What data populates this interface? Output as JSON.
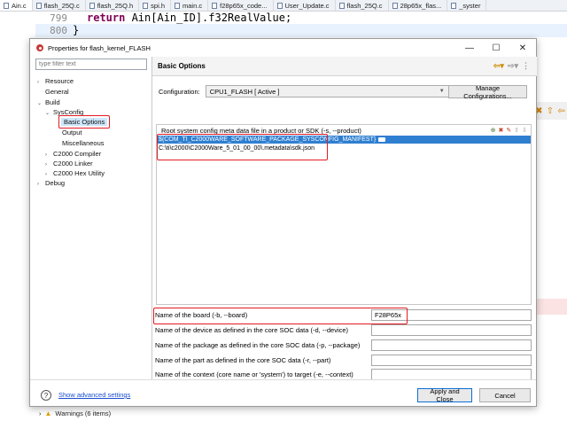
{
  "editor": {
    "tabs": [
      "Ain.c",
      "flash_25Q.c",
      "flash_25Q.h",
      "spi.h",
      "main.c",
      "f28p65x_code...",
      "User_Update.c",
      "flash_25Q.c",
      "28p65x_flas...",
      "_syster"
    ],
    "lines": [
      {
        "number": "799",
        "code_kw": "return",
        "code_rest": " Ain[Ain_ID].f32RealValue;"
      },
      {
        "number": "800",
        "code_rest": "}"
      }
    ],
    "bottom_status": "Warnings (6 items)"
  },
  "dialog": {
    "title": "Properties for flash_kernel_FLASH",
    "controls": {
      "minimize": "—",
      "maximize": "☐",
      "close": "✕"
    },
    "filter_placeholder": "type filter text",
    "tree": {
      "resource": "Resource",
      "general": "General",
      "build": "Build",
      "sysconfig": "SysConfig",
      "basic_options": "Basic Options",
      "output": "Output",
      "misc": "Miscellaneous",
      "compiler": "C2000 Compiler",
      "linker": "C2000 Linker",
      "hexutil": "C2000 Hex Utility",
      "debug": "Debug"
    },
    "panel_title": "Basic Options",
    "configuration": {
      "label": "Configuration:",
      "value": "CPU1_FLASH  [ Active ]",
      "manage_button": "Manage Configurations..."
    },
    "product_list": {
      "header": "Root system config meta data file in a product or SDK (-s, --product)",
      "items": [
        "${COM_TI_C2000WARE_SOFTWARE_PACKAGE_SYSCONFIG_MANIFEST}",
        "C:\\ti\\c2000\\C2000Ware_5_01_00_00\\.metadata\\sdk.json"
      ]
    },
    "fields": [
      {
        "label": "Name of the board (-b, --board)",
        "value": "F28P65x"
      },
      {
        "label": "Name of the device as defined in the core SOC data (-d, --device)",
        "value": ""
      },
      {
        "label": "Name of the package as defined in the core SOC data (-p, --package)",
        "value": ""
      },
      {
        "label": "Name of the part as defined in the core SOC data (-r, --part)",
        "value": ""
      },
      {
        "label": "Name of the context (core name or 'system') to target (-e, --context)",
        "value": ""
      }
    ],
    "footer": {
      "show_advanced": "Show advanced settings",
      "apply_close": "Apply and Close",
      "cancel": "Cancel"
    }
  },
  "colors": {
    "selection": "#2f7fd0",
    "highlight_box": "#e31b23",
    "link": "#1a4fd0"
  }
}
